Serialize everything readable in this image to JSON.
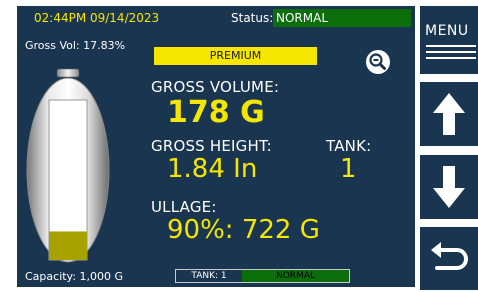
{
  "header": {
    "datetime": "02:44PM 09/14/2023",
    "status_label": "Status:",
    "status_value": "NORMAL"
  },
  "gross_vol_label": "Gross Vol: 17.83%",
  "product_label": "PREMIUM",
  "tank_fill_percent": 17.83,
  "fields": {
    "gross_volume_label": "GROSS VOLUME:",
    "gross_volume_value": "178 G",
    "gross_height_label": "GROSS HEIGHT:",
    "gross_height_value": "1.84 In",
    "tank_label": "TANK:",
    "tank_value": "1",
    "ullage_label": "ULLAGE:",
    "ullage_value": "90%: 722 G"
  },
  "capacity_label": "Capacity: 1,000 G",
  "footer": {
    "tank_label": "TANK: 1",
    "tank_status": "NORMAL"
  },
  "side_buttons": {
    "menu_label": "MENU"
  },
  "colors": {
    "panel": "#1a3550",
    "accent_yellow": "#f5e600",
    "status_green": "#0b6e0b",
    "fill_olive": "#a8a200"
  },
  "icons": [
    "zoom-out-icon",
    "arrow-up-icon",
    "arrow-down-icon",
    "back-arrow-icon",
    "hamburger-icon"
  ]
}
